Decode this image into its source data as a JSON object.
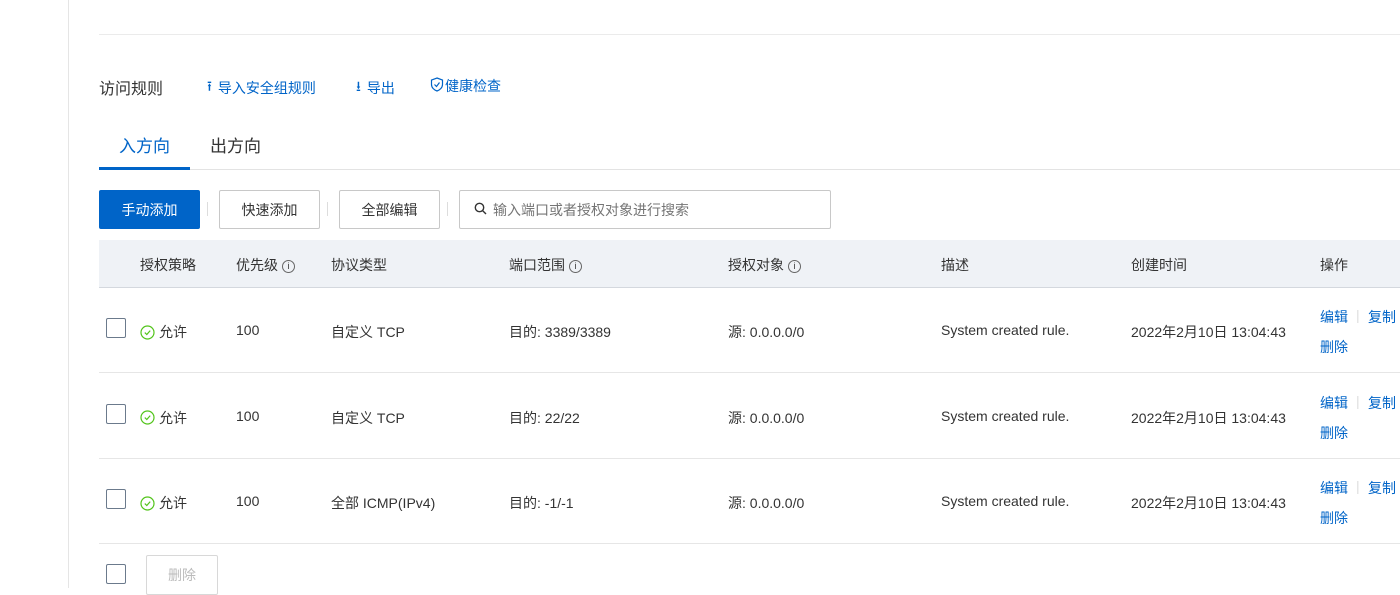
{
  "section_title": "访问规则",
  "actions": {
    "import": "导入安全组规则",
    "export": "导出",
    "health": "健康检查"
  },
  "tabs": [
    {
      "label": "入方向"
    },
    {
      "label": "出方向"
    }
  ],
  "toolbar": {
    "manual_add": "手动添加",
    "quick_add": "快速添加",
    "edit_all": "全部编辑",
    "search_placeholder": "输入端口或者授权对象进行搜索"
  },
  "columns": [
    "授权策略",
    "优先级",
    "协议类型",
    "端口范围",
    "授权对象",
    "描述",
    "创建时间",
    "操作"
  ],
  "rows": [
    {
      "policy": "允许",
      "priority": "100",
      "protocol": "自定义 TCP",
      "port": "目的: 3389/3389",
      "target": "源: 0.0.0.0/0",
      "desc": "System created rule.",
      "created": "2022年2月10日 13:04:43"
    },
    {
      "policy": "允许",
      "priority": "100",
      "protocol": "自定义 TCP",
      "port": "目的: 22/22",
      "target": "源: 0.0.0.0/0",
      "desc": "System created rule.",
      "created": "2022年2月10日 13:04:43"
    },
    {
      "policy": "允许",
      "priority": "100",
      "protocol": "全部 ICMP(IPv4)",
      "port": "目的: -1/-1",
      "target": "源: 0.0.0.0/0",
      "desc": "System created rule.",
      "created": "2022年2月10日 13:04:43"
    }
  ],
  "row_actions": {
    "edit": "编辑",
    "copy": "复制",
    "delete": "删除"
  },
  "footer": {
    "delete": "删除"
  },
  "colors": {
    "accent": "#0064c8",
    "success": "#52c41a"
  }
}
